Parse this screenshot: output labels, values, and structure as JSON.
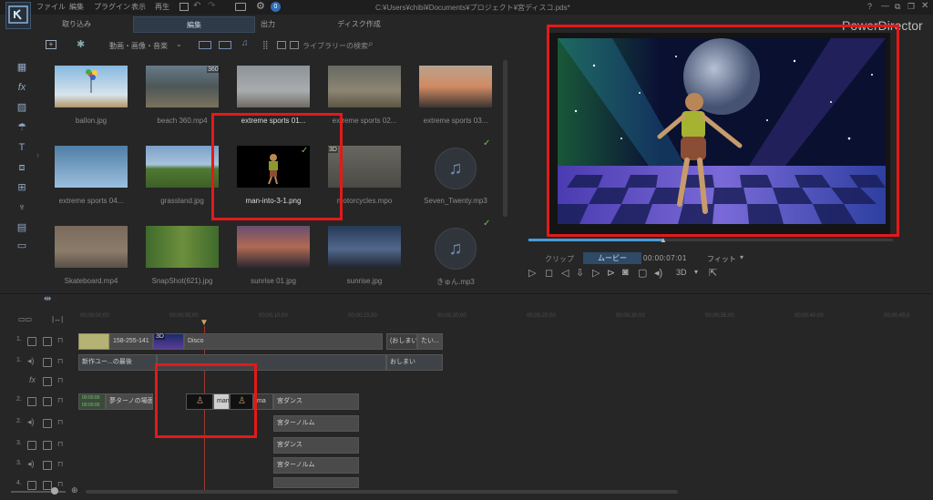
{
  "app": {
    "title_path": "C:¥Users¥chibi¥Documents¥プロジェクト¥宮ディスコ.pds*",
    "brand": "PowerDirector",
    "notification_count": "0",
    "menu": [
      "ファイル",
      "編集",
      "プラグイン",
      "表示",
      "再生"
    ]
  },
  "modes": {
    "capture": "取り込み",
    "edit": "編集",
    "produce": "出力",
    "disc": "ディスク作成"
  },
  "library": {
    "filter_label": "動画・画像・音楽",
    "search_placeholder": "ライブラリーの検索",
    "items": [
      {
        "label": "ballon.jpg",
        "kind": "image",
        "badge": ""
      },
      {
        "label": "beach 360.mp4",
        "kind": "video",
        "badge": "360"
      },
      {
        "label": "extreme sports 01...",
        "kind": "video",
        "badge": ""
      },
      {
        "label": "extreme sports 02...",
        "kind": "video",
        "badge": ""
      },
      {
        "label": "extreme sports 03...",
        "kind": "video",
        "badge": ""
      },
      {
        "label": "extreme sports 04...",
        "kind": "video",
        "badge": ""
      },
      {
        "label": "grassland.jpg",
        "kind": "image",
        "badge": ""
      },
      {
        "label": "man-into-3-1.png",
        "kind": "image",
        "badge": ""
      },
      {
        "label": "motorcycles.mpo",
        "kind": "image",
        "badge": "3D"
      },
      {
        "label": "Seven_Twenty.mp3",
        "kind": "audio",
        "badge": ""
      },
      {
        "label": "Skateboard.mp4",
        "kind": "video",
        "badge": ""
      },
      {
        "label": "SnapShot(621).jpg",
        "kind": "image",
        "badge": ""
      },
      {
        "label": "sunrise 01.jpg",
        "kind": "image",
        "badge": ""
      },
      {
        "label": "sunrise.jpg",
        "kind": "image",
        "badge": ""
      },
      {
        "label": "きゅん.mp3",
        "kind": "audio",
        "badge": ""
      }
    ]
  },
  "player": {
    "clip_tab": "クリップ",
    "movie_tab": "ムービー",
    "timecode": "00:00:07:01",
    "fit": "フィット",
    "stereo": "3D"
  },
  "timeline": {
    "ruler": [
      "00;00;00;00",
      "00;00;05;00",
      "00;00;10;00",
      "00;00;15;00",
      "00;00;20;00",
      "00;00;25;00",
      "00;00;30;00",
      "00;00;35;00",
      "00;00;40;00",
      "00;00;45;0"
    ],
    "tracks": [
      "1.",
      "1.",
      "",
      "2.",
      "2.",
      "3.",
      "3.",
      "4."
    ],
    "clips": {
      "c1": "158-255-141",
      "c2": "Disco",
      "c3": "(おしまい)",
      "c4": "たい...",
      "c5": "新作ユー...の最後",
      "c6": "おしまい",
      "c7": "00:00:00 00:00:00",
      "c8": "夢ターノの場面",
      "c9": "man",
      "c10": "ma",
      "c11": "宮ダンス",
      "c12": "宮ターノルム",
      "c13": "宮ダンス",
      "c14": "宮ターノルム"
    },
    "disco_badge": "3D"
  },
  "colors": {
    "accent": "#4a9bd8",
    "highlight": "#e41919",
    "check": "#6fc04e"
  }
}
